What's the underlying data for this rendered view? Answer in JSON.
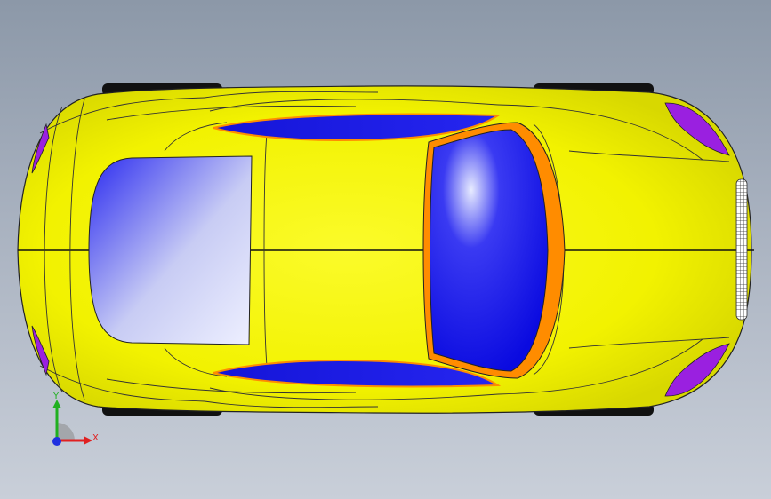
{
  "viewport": {
    "background_top": "#8c98a8",
    "background_bottom": "#c9cfd9"
  },
  "model": {
    "body_color": "#f5f500",
    "edge_color": "#222222",
    "glass_color": "#1010e8",
    "trim_color": "#ff8c00",
    "light_color": "#9a20e0",
    "tire_color": "#111111"
  },
  "triad": {
    "x_label": "X",
    "y_label": "Y",
    "x_color": "#e02020",
    "y_color": "#20b020",
    "z_color": "#2030e0"
  }
}
